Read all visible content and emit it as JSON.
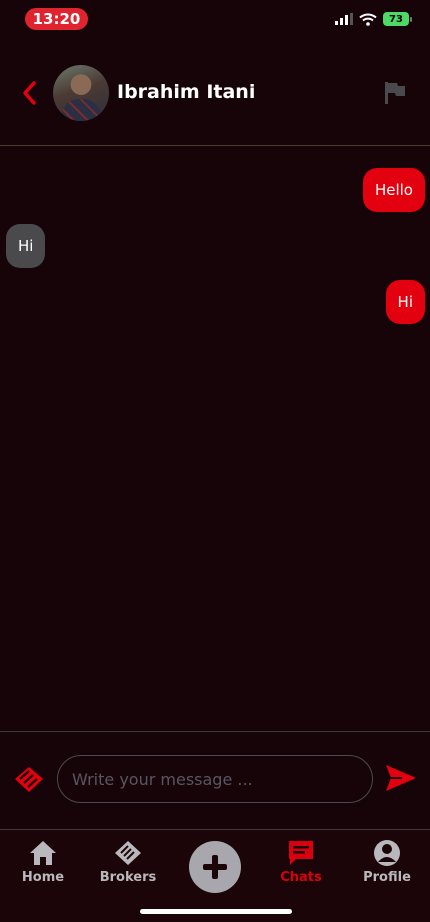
{
  "status_bar": {
    "time": "13:20",
    "battery": "73"
  },
  "header": {
    "contact_name": "Ibrahim Itani"
  },
  "messages": [
    {
      "direction": "out",
      "text": "Hello"
    },
    {
      "direction": "in",
      "text": "Hi"
    },
    {
      "direction": "out",
      "text": "Hi"
    }
  ],
  "composer": {
    "placeholder": "Write your message ..."
  },
  "tabs": [
    {
      "label": "Home",
      "icon": "home-icon"
    },
    {
      "label": "Brokers",
      "icon": "handshake-icon"
    },
    {
      "label": "Chats",
      "icon": "chat-icon",
      "active": true
    },
    {
      "label": "Profile",
      "icon": "user-circle-icon"
    }
  ],
  "colors": {
    "accent": "#e3000f",
    "background": "#160409",
    "bubble_in": "#4a4a4d"
  }
}
